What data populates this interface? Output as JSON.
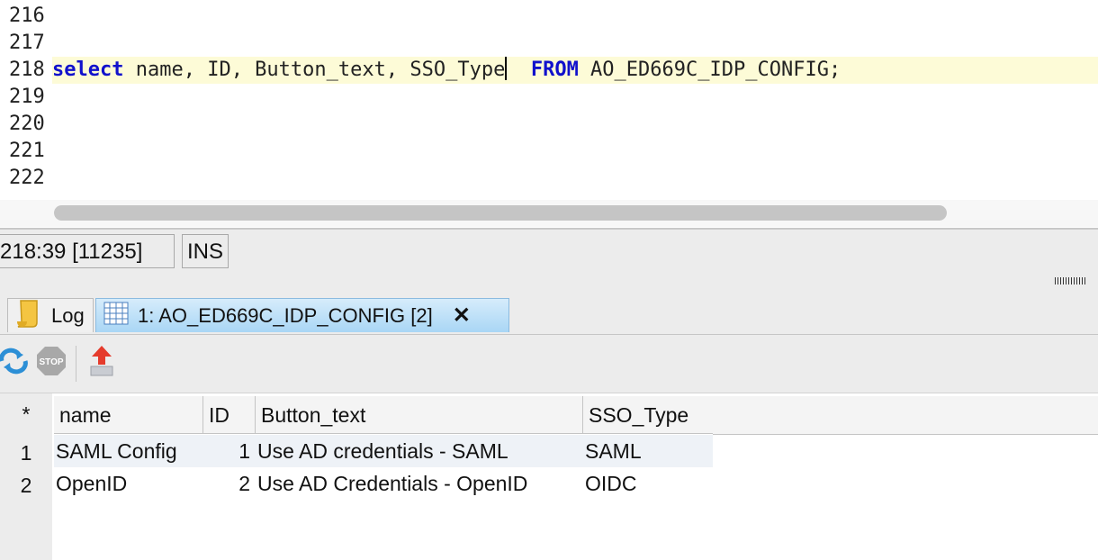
{
  "editor": {
    "lines": [
      {
        "num": "216"
      },
      {
        "num": "217"
      },
      {
        "num": "218",
        "kw1": "select",
        "mid": " name, ID, Button_text, SSO_Type",
        "gap": "  ",
        "kw2": "FROM",
        "rest": " AO_ED669C_IDP_CONFIG;"
      },
      {
        "num": "219"
      },
      {
        "num": "220"
      },
      {
        "num": "221"
      },
      {
        "num": "222"
      }
    ]
  },
  "status": {
    "position": "218:39 [11235]",
    "mode": "INS"
  },
  "tabs": [
    {
      "label": "Log",
      "icon": "scroll-icon"
    },
    {
      "label": "1: AO_ED669C_IDP_CONFIG [2]",
      "icon": "grid-icon",
      "close": "✕"
    }
  ],
  "toolbar": {
    "icons": [
      "refresh-icon",
      "stop-icon",
      "export-icon"
    ],
    "stop_text": "STOP"
  },
  "grid": {
    "corner": "*",
    "columns": [
      "name",
      "ID",
      "Button_text",
      "SSO_Type"
    ],
    "rows": [
      {
        "num": "1",
        "cells": [
          "SAML Config",
          "1",
          "Use AD credentials - SAML",
          "SAML"
        ]
      },
      {
        "num": "2",
        "cells": [
          "OpenID",
          "2",
          "Use AD Credentials - OpenID",
          "OIDC"
        ]
      }
    ]
  },
  "colors": {
    "keyword": "#1111cc",
    "current_line": "#fdfbd7",
    "active_tab": "#a9d6f5"
  }
}
